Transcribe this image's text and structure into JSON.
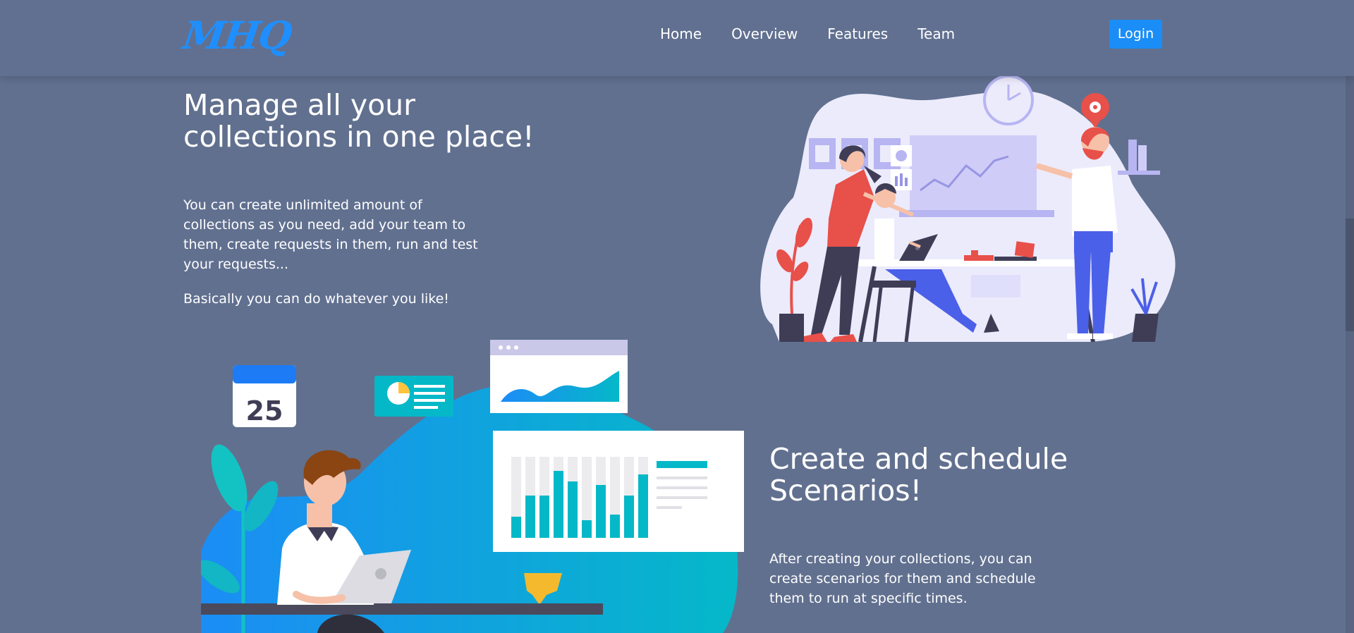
{
  "brand": {
    "logo_text": "MHQ"
  },
  "nav": {
    "items": [
      {
        "label": "Home"
      },
      {
        "label": "Overview"
      },
      {
        "label": "Features"
      },
      {
        "label": "Team"
      }
    ],
    "login_label": "Login"
  },
  "section1": {
    "title": "Manage all your collections in one place!",
    "paragraph1": "You can create unlimited amount of collections as you need, add your team to them, create requests in them, run and test your requests...",
    "paragraph2": "Basically you can do whatever you like!"
  },
  "section2": {
    "title": "Create and schedule Scenarios!",
    "paragraph1": "After creating your collections, you can create scenarios for them and schedule them to run at specific times.",
    "calendar_number": "25"
  },
  "colors": {
    "background": "#61708f",
    "accent": "#1b8df6",
    "illustration_purple": "#b7b5f2",
    "illustration_teal": "#05b8c8"
  }
}
